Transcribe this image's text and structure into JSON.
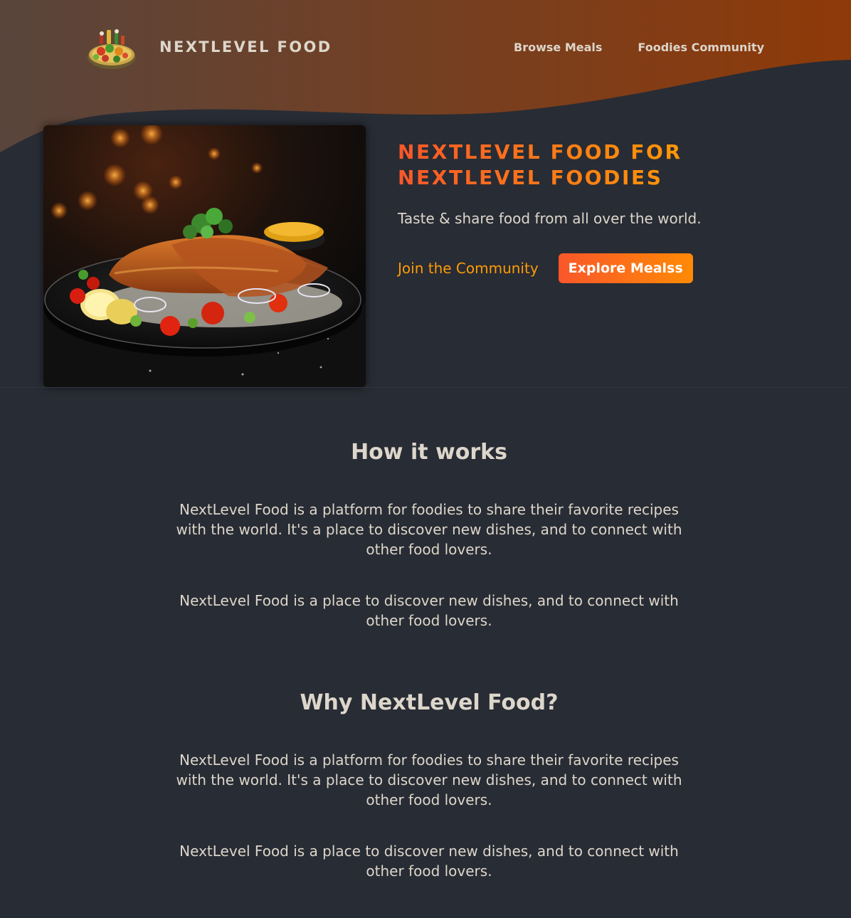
{
  "header": {
    "logo_text": "NextLevel Food",
    "logo_icon": "food-plate-logo",
    "nav": {
      "browse_meals": "Browse Meals",
      "foodies_community": "Foodies Community"
    }
  },
  "hero": {
    "image_alt": "A delicious, juicy schnitzel with salad on a black plate",
    "title": "NextLevel Food for NextLevel Foodies",
    "subtitle": "Taste & share food from all over the world.",
    "join_link": "Join the Community",
    "explore_button": "Explore Mealss"
  },
  "how_it_works": {
    "title": "How it works",
    "paragraph_1": "NextLevel Food is a platform for foodies to share their favorite recipes with the world. It's a place to discover new dishes, and to connect with other food lovers.",
    "paragraph_2": "NextLevel Food is a place to discover new dishes, and to connect with other food lovers."
  },
  "why": {
    "title": "Why NextLevel Food?",
    "paragraph_1": "NextLevel Food is a platform for foodies to share their favorite recipes with the world. It's a place to discover new dishes, and to connect with other food lovers.",
    "paragraph_2": "NextLevel Food is a place to discover new dishes, and to connect with other food lovers."
  },
  "colors": {
    "background": "#282c34",
    "text": "#ddd6cb",
    "accent_start": "#f9572a",
    "accent_end": "#ff9b05",
    "header_gradient_start": "#59453c",
    "header_gradient_end": "#8f3a09"
  }
}
